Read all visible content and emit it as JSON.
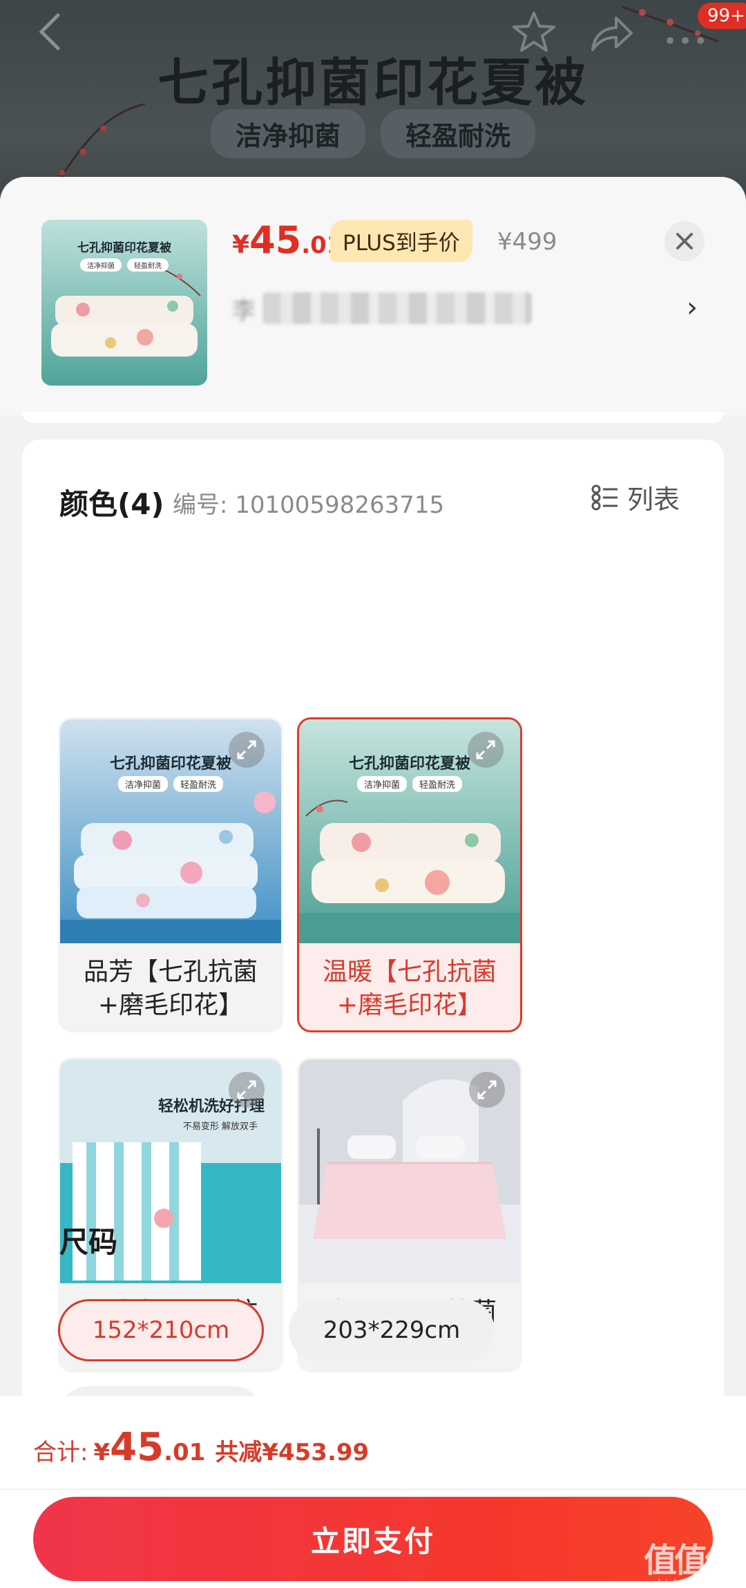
{
  "background": {
    "title": "七孔抑菌印花夏被",
    "tags": [
      "洁净抑菌",
      "轻盈耐洗"
    ],
    "badge": "99+"
  },
  "product": {
    "price_symbol": "¥",
    "price_int": "45",
    "price_dec": ".01",
    "plus_label": "PLUS到手价",
    "original_price": "¥499",
    "shipping_first_char": "李",
    "thumb_caption": "七孔抑菌印花夏被",
    "thumb_tags": [
      "洁净抑菌",
      "轻盈耐洗"
    ]
  },
  "color_section": {
    "title": "颜色(4)",
    "code_label": "编号: 10100598263715",
    "list_label": "列表",
    "options": [
      {
        "label": "品芳【七孔抗菌+磨毛印花】",
        "caption": "七孔抑菌印花夏被",
        "tags": [
          "洁净抑菌",
          "轻盈耐洗"
        ],
        "selected": false
      },
      {
        "label": "温暖【七孔抗菌+磨毛印花】",
        "caption": "七孔抑菌印花夏被",
        "tags": [
          "洁净抑菌",
          "轻盈耐洗"
        ],
        "selected": true
      },
      {
        "label": "夏威夷【七孔抗菌+磨毛印花】",
        "caption": "轻松机洗好打理",
        "tags": [
          "不易变形 解放双手"
        ],
        "selected": false
      },
      {
        "label": "佳人【七孔抗菌+轻松机洗】",
        "caption": "",
        "tags": [],
        "selected": false
      }
    ]
  },
  "size_section": {
    "title": "尺码",
    "options": [
      {
        "label": "152*210cm",
        "selected": true
      },
      {
        "label": "203*229cm",
        "selected": false
      }
    ]
  },
  "footer": {
    "total_label": "合计:",
    "total_symbol": "¥",
    "total_int": "45",
    "total_dec": ".01",
    "discount": "共减¥453.99",
    "pay_label": "立即支付"
  },
  "watermark": {
    "big": "值值值",
    "small": "zhizhizhi.com"
  },
  "colors": {
    "accent": "#e02e24",
    "plus_bg": "#fde7b2",
    "pay_button": "#f5382c"
  }
}
